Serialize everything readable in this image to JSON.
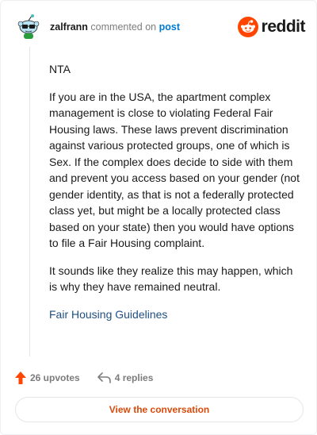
{
  "header": {
    "username": "zalfrann",
    "action_text": "commented on",
    "post_link": "post",
    "brand": "reddit"
  },
  "comment": {
    "paragraphs": [
      "NTA",
      "If you are in the USA, the apartment complex management is close to violating Federal Fair Housing laws. These laws prevent discrimination against various protected groups, one of which is Sex. If the complex does decide to side with them and prevent you access based on your gender (not gender identity, as that is not a federally protected class yet, but might be a locally protected class based on your state) then you would have options to file a Fair Housing complaint.",
      "It sounds like they realize this may happen, which is why they have remained neutral."
    ],
    "link_text": "Fair Housing Guidelines"
  },
  "actions": {
    "upvotes": "26 upvotes",
    "replies": "4 replies"
  },
  "view_button": "View the conversation",
  "icons": {
    "avatar": "snoo-avatar-icon",
    "logo": "reddit-logo-icon",
    "upvote": "upvote-arrow-icon",
    "reply": "reply-arrow-icon"
  },
  "colors": {
    "brand_orange": "#ff4500",
    "link_blue": "#0079d3",
    "upvote_orange": "#ff4500",
    "button_text": "#d94a0a"
  }
}
